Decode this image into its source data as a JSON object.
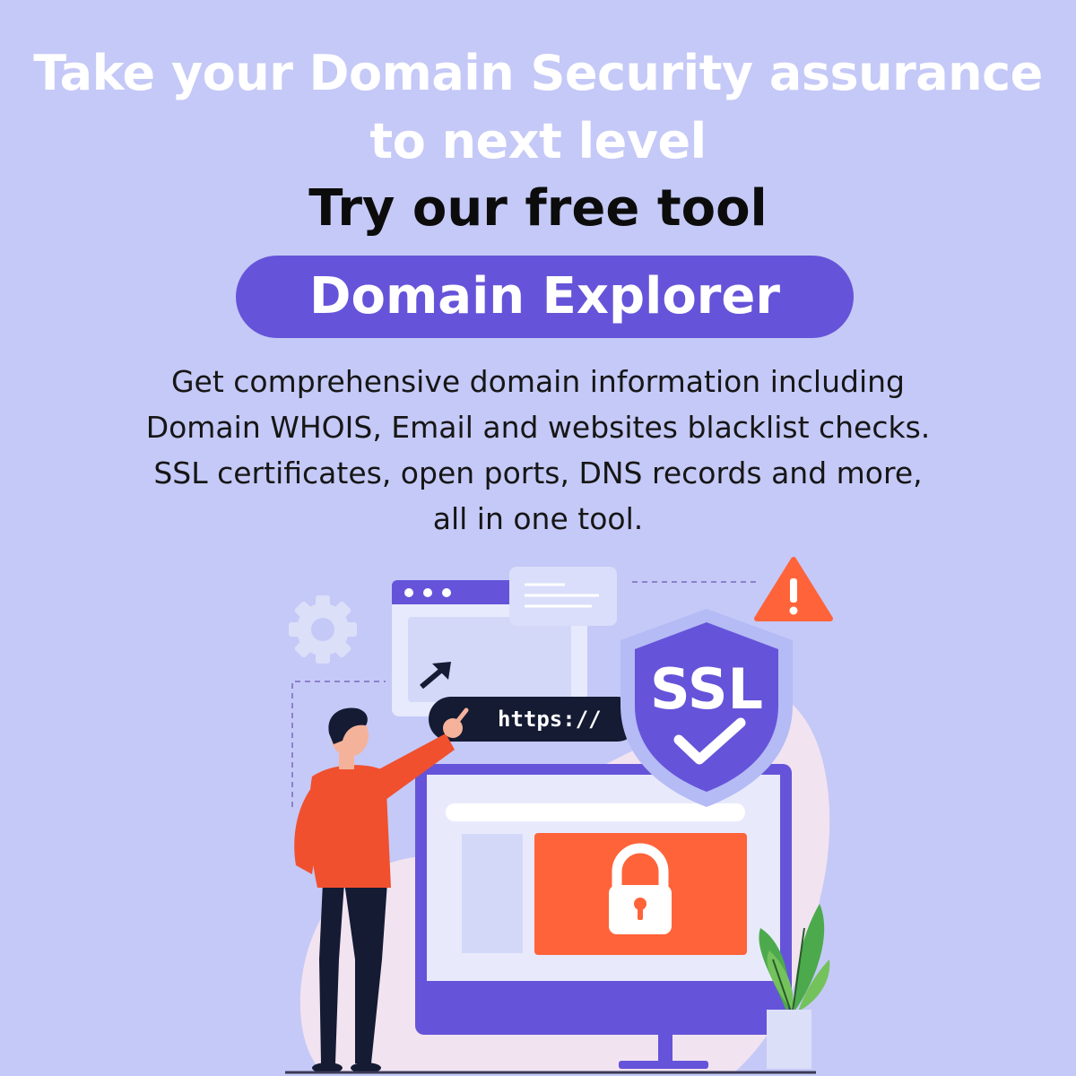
{
  "headline": {
    "line1": "Take your Domain Security assurance",
    "line2": "to next level"
  },
  "subheadline": "Try our free tool",
  "cta": {
    "label": "Domain Explorer"
  },
  "description": {
    "line1": "Get comprehensive domain information including",
    "line2": "Domain WHOIS, Email and websites blacklist checks.",
    "line3": "SSL certificates, open ports, DNS records and more,",
    "line4": "all in one tool."
  },
  "illustration": {
    "url_text": "https://",
    "shield_text": "SSL",
    "icons": [
      "gear-icon",
      "warning-icon",
      "cursor-arrow-icon",
      "padlock-icon",
      "checkmark-icon",
      "plant-icon"
    ]
  },
  "colors": {
    "background": "#c5c9f7",
    "accent_purple": "#6554d9",
    "alert_orange": "#ff6339",
    "shirt_orange": "#f0502e",
    "dark_navy": "#141b33"
  }
}
